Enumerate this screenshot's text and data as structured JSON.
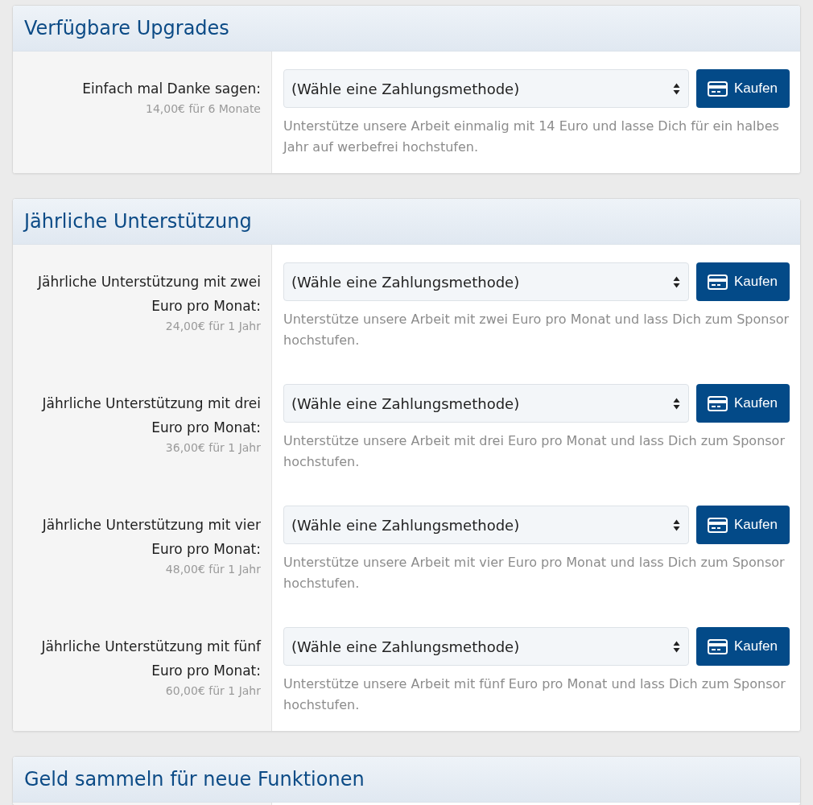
{
  "panels": [
    {
      "title": "Verfügbare Upgrades",
      "offers": [
        {
          "label": "Einfach mal Danke sagen:",
          "price": "14,00€ für 6 Monate",
          "payment_select": "(Wähle eine Zahlungsmethode)",
          "buy_button": "Kaufen",
          "description": "Unterstütze unsere Arbeit einmalig mit 14 Euro und lasse Dich für ein halbes Jahr auf werbefrei hochstufen."
        }
      ]
    },
    {
      "title": "Jährliche Unterstützung",
      "offers": [
        {
          "label": "Jährliche Unterstützung mit zwei Euro pro Monat:",
          "price": "24,00€ für 1 Jahr",
          "payment_select": "(Wähle eine Zahlungsmethode)",
          "buy_button": "Kaufen",
          "description": "Unterstütze unsere Arbeit mit zwei Euro pro Monat und lass Dich zum Sponsor hochstufen."
        },
        {
          "label": "Jährliche Unterstützung mit drei Euro pro Monat:",
          "price": "36,00€ für 1 Jahr",
          "payment_select": "(Wähle eine Zahlungsmethode)",
          "buy_button": "Kaufen",
          "description": "Unterstütze unsere Arbeit mit drei Euro pro Monat und lass Dich zum Sponsor hochstufen."
        },
        {
          "label": "Jährliche Unterstützung mit vier Euro pro Monat:",
          "price": "48,00€ für 1 Jahr",
          "payment_select": "(Wähle eine Zahlungsmethode)",
          "buy_button": "Kaufen",
          "description": "Unterstütze unsere Arbeit mit vier Euro pro Monat und lass Dich zum Sponsor hochstufen."
        },
        {
          "label": "Jährliche Unterstützung mit fünf Euro pro Monat:",
          "price": "60,00€ für 1 Jahr",
          "payment_select": "(Wähle eine Zahlungsmethode)",
          "buy_button": "Kaufen",
          "description": "Unterstütze unsere Arbeit mit fünf Euro pro Monat und lass Dich zum Sponsor hochstufen."
        }
      ]
    },
    {
      "title": "Geld sammeln für neue Funktionen"
    }
  ]
}
